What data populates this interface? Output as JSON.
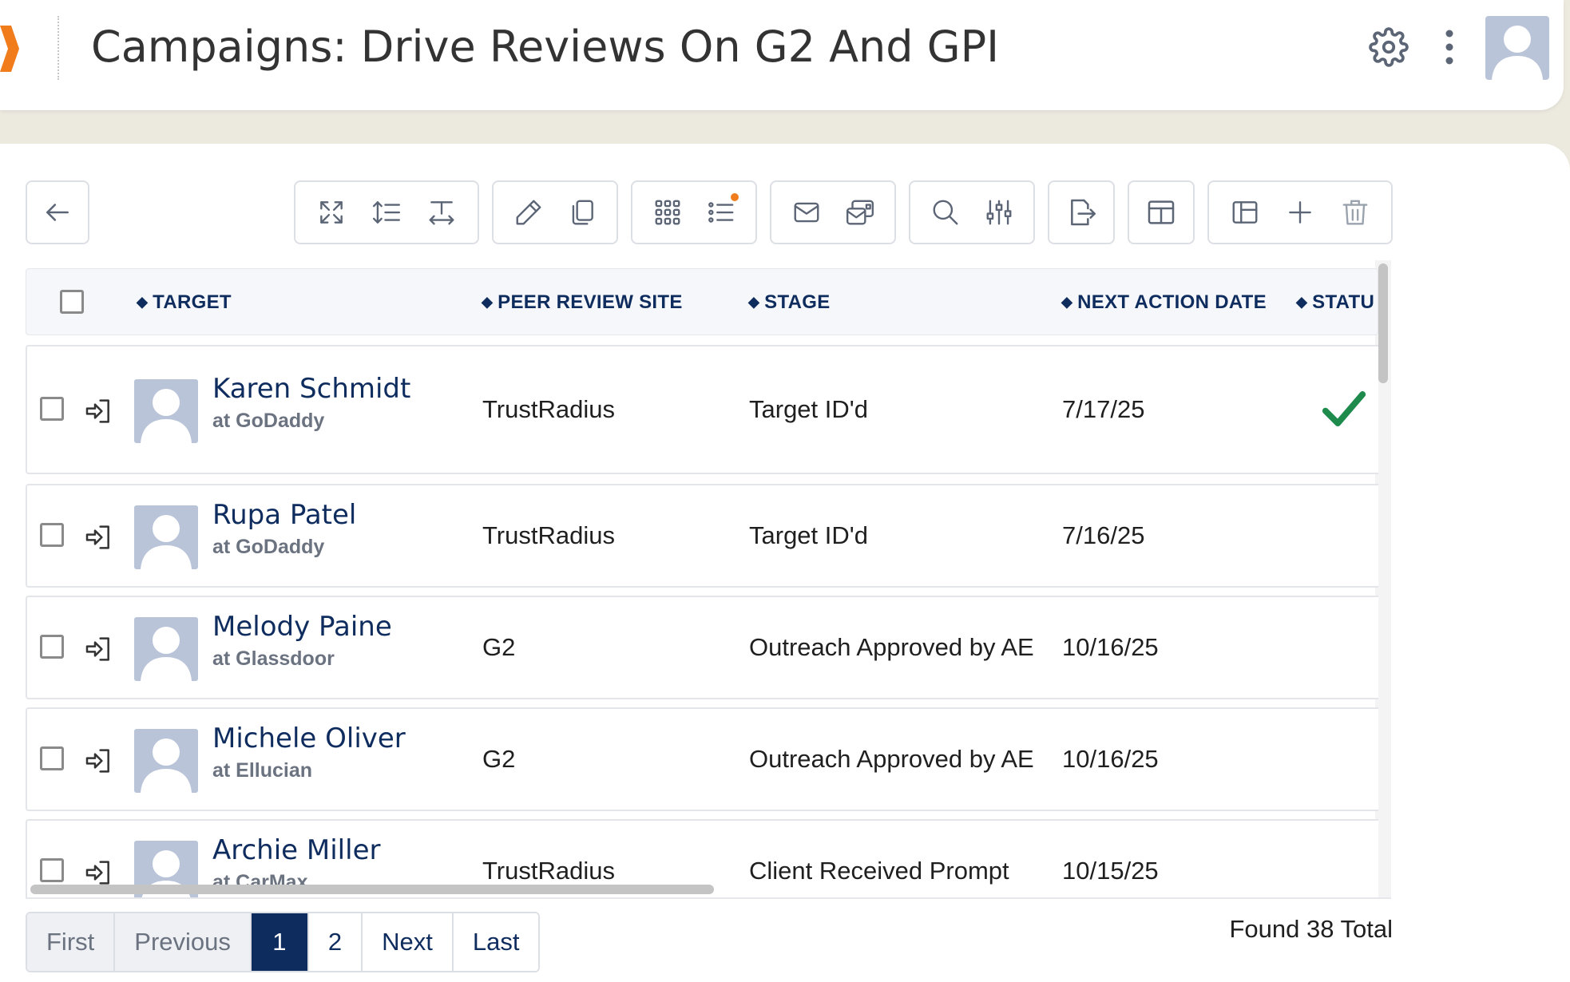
{
  "header": {
    "title": "Campaigns: Drive Reviews On G2 And GPI"
  },
  "colors": {
    "brand_orange": "#f07c1c",
    "navy": "#0f2c5e",
    "success_green": "#1e8a4c"
  },
  "toolbar": {
    "back_icon": "arrow-left-icon",
    "groups": [
      [
        "expand-icon",
        "line-height-icon",
        "text-width-icon"
      ],
      [
        "pencil-icon",
        "copy-icon"
      ],
      [
        "grid-icon",
        "list-icon"
      ],
      [
        "mail-icon",
        "mail-cards-icon"
      ],
      [
        "search-icon",
        "filter-sliders-icon"
      ],
      [
        "export-icon"
      ],
      [
        "layout-icon"
      ],
      [
        "sidebar-layout-icon",
        "plus-icon",
        "trash-icon"
      ]
    ]
  },
  "table": {
    "columns": [
      {
        "key": "target",
        "label": "TARGET"
      },
      {
        "key": "site",
        "label": "PEER REVIEW SITE"
      },
      {
        "key": "stage",
        "label": "STAGE"
      },
      {
        "key": "next_date",
        "label": "NEXT ACTION DATE"
      },
      {
        "key": "status",
        "label": "STATU"
      }
    ],
    "rows": [
      {
        "name": "Karen Schmidt",
        "company": "at GoDaddy",
        "site": "TrustRadius",
        "stage": "Target ID'd",
        "next_date": "7/17/25",
        "status_icon": "check-icon"
      },
      {
        "name": "Rupa Patel",
        "company": "at GoDaddy",
        "site": "TrustRadius",
        "stage": "Target ID'd",
        "next_date": "7/16/25",
        "status_icon": ""
      },
      {
        "name": "Melody Paine",
        "company": "at Glassdoor",
        "site": "G2",
        "stage": "Outreach Approved by AE",
        "next_date": "10/16/25",
        "status_icon": ""
      },
      {
        "name": "Michele Oliver",
        "company": "at Ellucian",
        "site": "G2",
        "stage": "Outreach Approved by AE",
        "next_date": "10/16/25",
        "status_icon": ""
      },
      {
        "name": "Archie Miller",
        "company": "at CarMax",
        "site": "TrustRadius",
        "stage": "Client Received Prompt",
        "next_date": "10/15/25",
        "status_icon": ""
      }
    ]
  },
  "pagination": {
    "first": "First",
    "previous": "Previous",
    "page1": "1",
    "page2": "2",
    "next": "Next",
    "last": "Last",
    "current_page": 1
  },
  "summary": {
    "found": "Found 38 Total"
  }
}
